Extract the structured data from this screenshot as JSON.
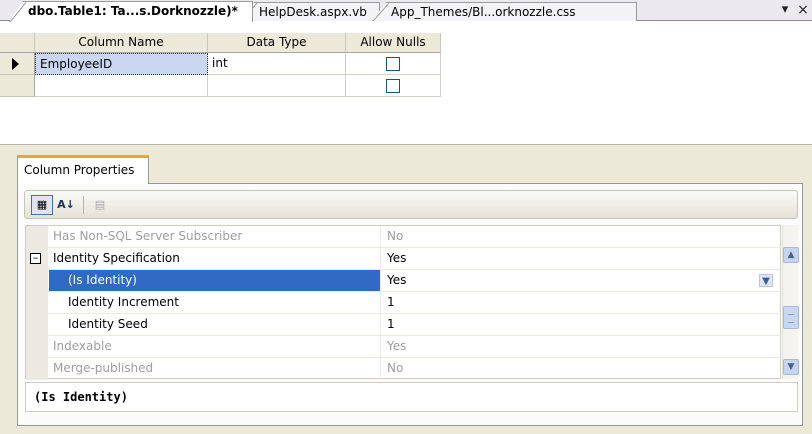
{
  "tabs": [
    {
      "label": "dbo.Table1: Ta...s.Dorknozzle)*",
      "active": true
    },
    {
      "label": "HelpDesk.aspx.vb",
      "active": false
    },
    {
      "label": "App_Themes/Bl...orknozzle.css",
      "active": false
    }
  ],
  "tabstrip": {
    "dropdown_icon": "▾",
    "close_icon": "×"
  },
  "grid": {
    "headers": {
      "column_name": "Column Name",
      "data_type": "Data Type",
      "allow_nulls": "Allow Nulls"
    },
    "rows": [
      {
        "column_name": "EmployeeID",
        "data_type": "int",
        "allow_nulls": false,
        "current": true
      },
      {
        "column_name": "",
        "data_type": "",
        "allow_nulls": false,
        "current": false
      }
    ]
  },
  "properties_panel": {
    "tab_label": "Column Properties",
    "toolbar": {
      "categorized_icon": "categorized-icon",
      "alphabetical_icon": "alphabetical-sort-icon",
      "property_pages_icon": "property-pages-icon"
    },
    "rows": [
      {
        "name": "Has Non-SQL Server Subscriber",
        "value": "No",
        "disabled": true
      },
      {
        "name": "Identity Specification",
        "value": "Yes",
        "expandable": true,
        "expanded": true
      },
      {
        "name": "(Is Identity)",
        "value": "Yes",
        "selected": true,
        "has_dropdown": true
      },
      {
        "name": "Identity Increment",
        "value": "1"
      },
      {
        "name": "Identity Seed",
        "value": "1"
      },
      {
        "name": "Indexable",
        "value": "Yes",
        "disabled": true
      },
      {
        "name": "Merge-published",
        "value": "No",
        "disabled": true
      }
    ],
    "description_title": "(Is Identity)"
  },
  "colors": {
    "selection": "#316ac5",
    "selected_cell": "#c9d7f3",
    "active_tab_accent": "#e8a53b",
    "panel_background": "#ece9d8"
  }
}
